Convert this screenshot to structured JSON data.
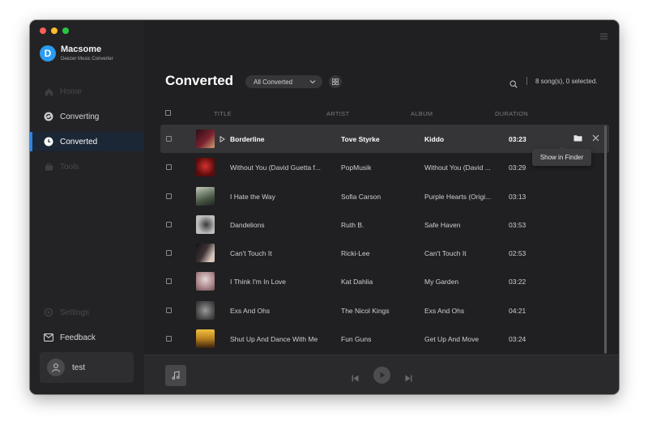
{
  "app": {
    "name": "Macsome",
    "subtitle": "Deezer Music Converter",
    "logo_letter": "D",
    "accent_color": "#2e83e4"
  },
  "sidebar": {
    "items": [
      {
        "label": "Home",
        "icon": "home-icon",
        "state": "disabled"
      },
      {
        "label": "Converting",
        "icon": "converting-icon",
        "state": "normal"
      },
      {
        "label": "Converted",
        "icon": "clock-icon",
        "state": "active"
      },
      {
        "label": "Tools",
        "icon": "toolbox-icon",
        "state": "disabled"
      }
    ],
    "bottom": [
      {
        "label": "Settings",
        "icon": "gear-icon",
        "state": "disabled"
      },
      {
        "label": "Feedback",
        "icon": "mail-icon",
        "state": "normal"
      }
    ],
    "user": {
      "name": "test"
    }
  },
  "main": {
    "title": "Converted",
    "filter": {
      "selected": "All Converted"
    },
    "summary": "8 song(s), 0 selected.",
    "columns": {
      "title": "TITLE",
      "artist": "ARTIST",
      "album": "ALBUM",
      "duration": "DURATION"
    },
    "tooltip": "Show in Finder",
    "rows": [
      {
        "title": "Borderline",
        "artist": "Tove Styrke",
        "album": "Kiddo",
        "duration": "03:23",
        "highlighted": true,
        "thumb": "#7a2230"
      },
      {
        "title": "Without You (David Guetta f...",
        "artist": "PopMusik",
        "album": "Without You (David ...",
        "duration": "03:29",
        "highlighted": false,
        "thumb": "#8a1e1e"
      },
      {
        "title": "I Hate the Way",
        "artist": "Sofia Carson",
        "album": "Purple Hearts (Origi...",
        "duration": "03:13",
        "highlighted": false,
        "thumb": "#6d7a6a"
      },
      {
        "title": "Dandelions",
        "artist": "Ruth B.",
        "album": "Safe Haven",
        "duration": "03:53",
        "highlighted": false,
        "thumb": "#8c8c8c"
      },
      {
        "title": "Can't Touch It",
        "artist": "Ricki-Lee",
        "album": "Can't Touch It",
        "duration": "02:53",
        "highlighted": false,
        "thumb": "#3e3236"
      },
      {
        "title": "I Think I'm In Love",
        "artist": "Kat Dahlia",
        "album": "My Garden",
        "duration": "03:22",
        "highlighted": false,
        "thumb": "#c9b8bb"
      },
      {
        "title": "Exs And Ohs",
        "artist": "The Nicol Kings",
        "album": "Exs And Ohs",
        "duration": "04:21",
        "highlighted": false,
        "thumb": "#707070"
      },
      {
        "title": "Shut Up And Dance With Me",
        "artist": "Fun Guns",
        "album": "Get Up And Move",
        "duration": "03:24",
        "highlighted": false,
        "thumb": "#b8801f"
      }
    ]
  }
}
